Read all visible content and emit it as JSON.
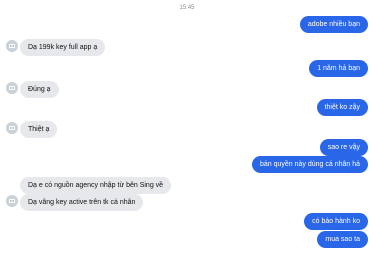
{
  "chat": {
    "timestamp": "15:45",
    "messages": [
      {
        "side": "out",
        "text": "adobe nhiều bạn"
      },
      {
        "side": "in",
        "text": "Dạ 199k key full app ạ"
      },
      {
        "side": "out",
        "text": "1 năm hả bạn"
      },
      {
        "side": "in",
        "text": "Đúng ạ"
      },
      {
        "side": "out",
        "text": "thiệt ko zậy"
      },
      {
        "side": "in",
        "text": "Thiệt ạ"
      },
      {
        "side": "out",
        "text": "sao re vậy"
      },
      {
        "side": "out",
        "text": "bản quyền này dùng cá nhân hả"
      },
      {
        "side": "in",
        "text": "Dạ e có nguồn agency nhập từ bên Sing về"
      },
      {
        "side": "in",
        "text": "Dạ vâng key active trên tk cá nhân"
      },
      {
        "side": "out",
        "text": "có bảo hành ko"
      },
      {
        "side": "out",
        "text": "mua sao ta"
      }
    ]
  },
  "colors": {
    "outgoing_bubble": "#2a66e8",
    "incoming_bubble": "#e6e8ec",
    "avatar": "#c8d2d8"
  },
  "icons": {
    "avatar": "avatar-icon"
  }
}
